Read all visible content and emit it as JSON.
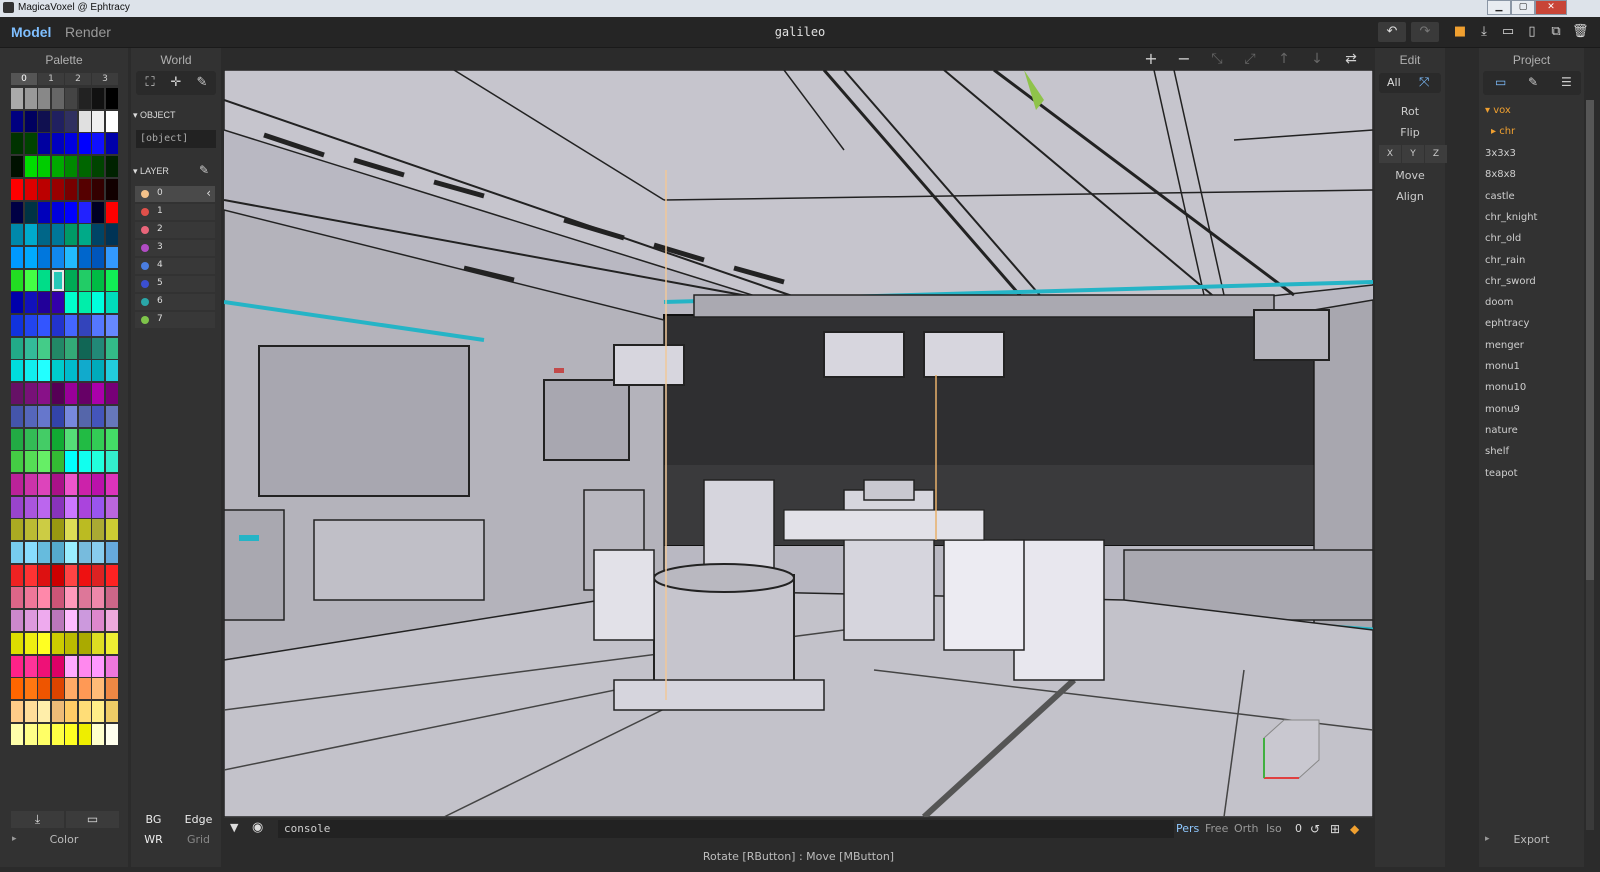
{
  "window": {
    "title": "MagicaVoxel @ Ephtracy",
    "minimize_icon": "minimize-icon",
    "maximize_icon": "maximize-icon",
    "close_icon": "close-icon"
  },
  "appbar": {
    "modes": [
      "Model",
      "Render"
    ],
    "active_mode": "Model",
    "filename": "galileo",
    "icons": [
      "undo-icon",
      "redo-icon",
      "save-icon",
      "download-icon",
      "open-folder-icon",
      "new-file-icon",
      "copy-file-icon",
      "delete-icon"
    ]
  },
  "palette": {
    "title": "Palette",
    "tabs": [
      "0",
      "1",
      "2",
      "3"
    ],
    "active_tab": "0",
    "footer_label": "Color",
    "colors": {
      "selected": "#27c7b8"
    }
  },
  "world": {
    "title": "World",
    "object_section": "OBJECT",
    "object_value": "[object]",
    "layer_section": "LAYER",
    "layers": [
      {
        "label": "0",
        "color": "#f4c28a"
      },
      {
        "label": "1",
        "color": "#e0504a"
      },
      {
        "label": "2",
        "color": "#e9657a"
      },
      {
        "label": "3",
        "color": "#b24cc5"
      },
      {
        "label": "4",
        "color": "#4a7de0"
      },
      {
        "label": "5",
        "color": "#3b4fd0"
      },
      {
        "label": "6",
        "color": "#2aa6a8"
      },
      {
        "label": "7",
        "color": "#7ec44a"
      }
    ],
    "bottom_buttons": [
      {
        "label": "BG",
        "active": true
      },
      {
        "label": "Edge",
        "active": true
      },
      {
        "label": "WR",
        "active": true
      },
      {
        "label": "Grid",
        "active": false
      }
    ]
  },
  "viewport": {
    "console_placeholder": "console",
    "camera_modes": [
      "Pers",
      "Free",
      "Orth",
      "Iso"
    ],
    "active_camera": "Pers",
    "zoom_value": "0",
    "status": "Rotate [RButton] : Move [MButton]"
  },
  "edit": {
    "title": "Edit",
    "tabs": [
      "All"
    ],
    "actions": [
      "Rot",
      "Flip",
      "Move",
      "Align"
    ],
    "axes": [
      "X",
      "Y",
      "Z"
    ]
  },
  "project": {
    "title": "Project",
    "folders": [
      {
        "label": "vox",
        "expanded": true
      },
      {
        "label": "chr",
        "expanded": false
      }
    ],
    "files": [
      "3x3x3",
      "8x8x8",
      "castle",
      "chr_knight",
      "chr_old",
      "chr_rain",
      "chr_sword",
      "doom",
      "ephtracy",
      "menger",
      "monu1",
      "monu10",
      "monu9",
      "nature",
      "shelf",
      "teapot"
    ],
    "export_label": "Export",
    "folder_color": "#f0a030"
  }
}
